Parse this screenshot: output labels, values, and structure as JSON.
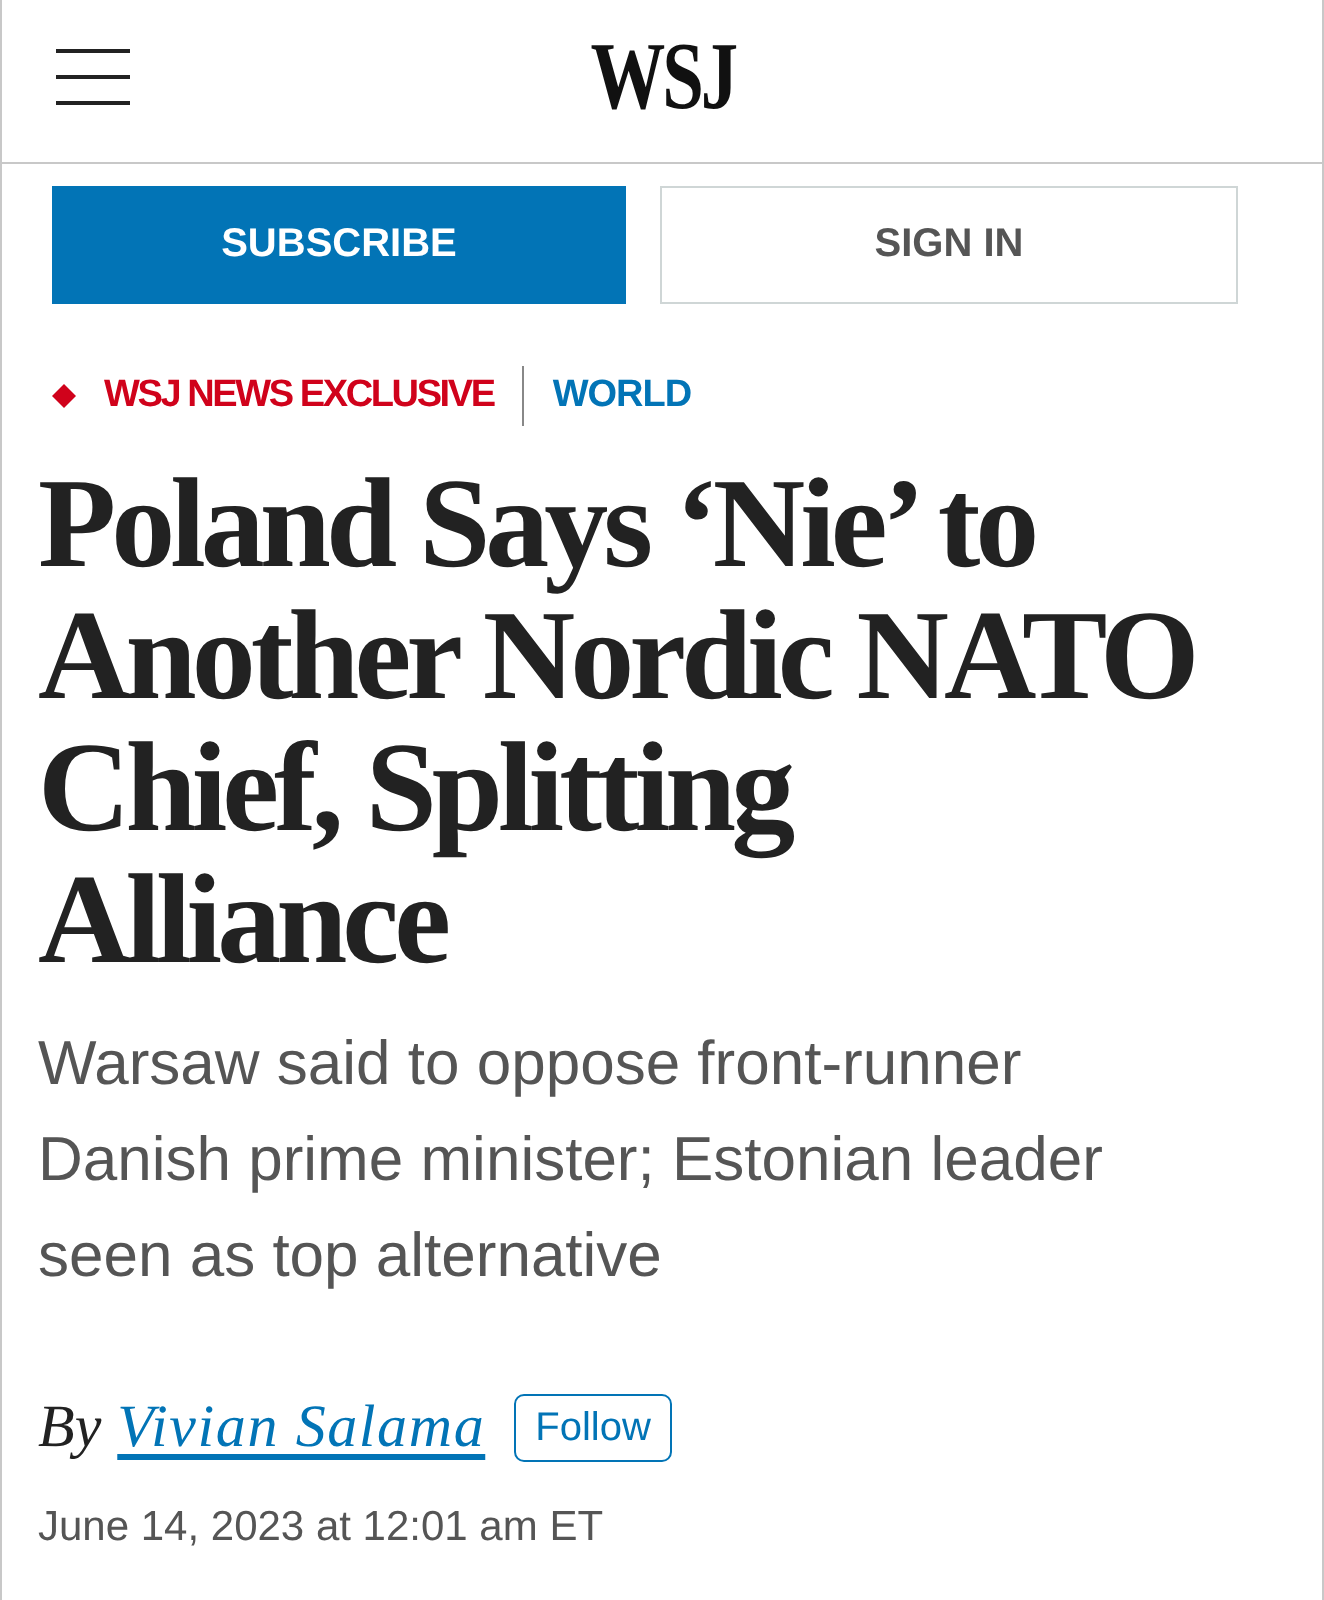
{
  "header": {
    "logo": "WSJ"
  },
  "auth_buttons": [
    {
      "label": "SUBSCRIBE",
      "kind": "primary"
    },
    {
      "label": "SIGN IN",
      "kind": "secondary"
    }
  ],
  "kicker": {
    "flag": "WSJ NEWS EXCLUSIVE",
    "section": "WORLD"
  },
  "headline": "Poland Says ‘Nie’ to Another Nordic NATO Chief, Splitting Alliance",
  "dek": "Warsaw said to oppose front-runner Danish prime minister; Estonian leader seen as top alternative",
  "byline": {
    "prefix": "By",
    "author": "Vivian Salama",
    "follow": "Follow"
  },
  "timestamp": "June 14, 2023 at 12:01 am ET"
}
